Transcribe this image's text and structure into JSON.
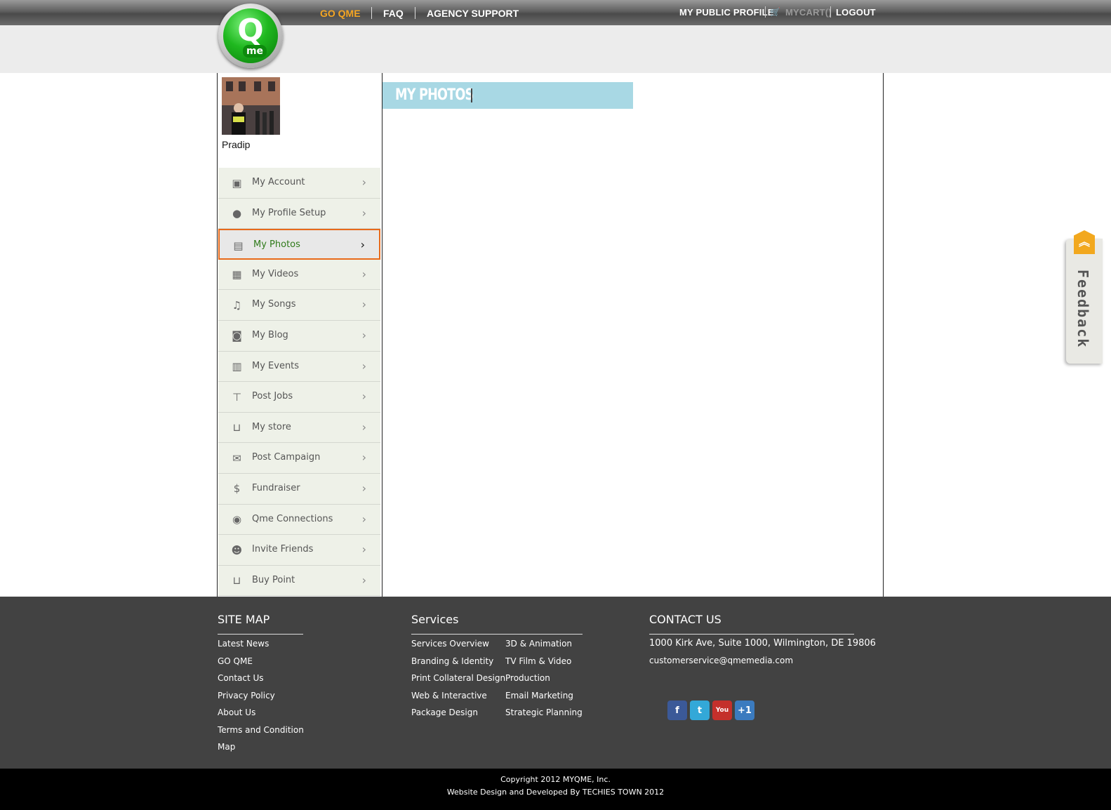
{
  "header": {
    "logo_letter": "Q",
    "logo_sub": "me",
    "nav": [
      {
        "label": "GO QME",
        "color": "#f5a623"
      },
      {
        "label": "FAQ"
      },
      {
        "label": "AGENCY SUPPORT"
      }
    ],
    "right_nav": {
      "public_profile": "MY PUBLIC PROFILE",
      "cart": "MYCART()",
      "logout": "LOGOUT"
    }
  },
  "user": {
    "name": "Pradip"
  },
  "sidebar": {
    "items": [
      {
        "label": "My Account",
        "icon": "account-icon",
        "glyph": "▣"
      },
      {
        "label": "My Profile Setup",
        "icon": "person-icon",
        "glyph": "●"
      },
      {
        "label": "My Photos",
        "icon": "photos-icon",
        "glyph": "▤",
        "active": true
      },
      {
        "label": "My Videos",
        "icon": "clapper-icon",
        "glyph": "▦"
      },
      {
        "label": "My Songs",
        "icon": "music-icon",
        "glyph": "♫"
      },
      {
        "label": "My Blog",
        "icon": "blog-icon",
        "glyph": "◙"
      },
      {
        "label": "My Events",
        "icon": "calendar-icon",
        "glyph": "▥"
      },
      {
        "label": "Post Jobs",
        "icon": "signpost-icon",
        "glyph": "⊤"
      },
      {
        "label": "My store",
        "icon": "cart-icon",
        "glyph": "⊔"
      },
      {
        "label": "Post Campaign",
        "icon": "envelope-icon",
        "glyph": "✉"
      },
      {
        "label": "Fundraiser",
        "icon": "dollar-icon",
        "glyph": "$"
      },
      {
        "label": "Qme Connections",
        "icon": "qme-icon",
        "glyph": "◉"
      },
      {
        "label": "Invite Friends",
        "icon": "friends-icon",
        "glyph": "☻"
      },
      {
        "label": "Buy Point",
        "icon": "basket-icon",
        "glyph": "⊔"
      }
    ],
    "arrow": "›"
  },
  "main": {
    "title": "MY PHOTOS"
  },
  "feedback": {
    "label": "Feedback",
    "button": "︽"
  },
  "footer": {
    "sitemap": {
      "heading": "SITE MAP",
      "links": [
        "Latest News",
        "GO QME",
        "Contact Us",
        "Privacy Policy",
        "About Us",
        "Terms and Condition",
        "Map"
      ]
    },
    "services": {
      "heading": "Services",
      "col1": [
        "Services Overview",
        "Branding & Identity",
        "Print Collateral Design",
        "Web & Interactive",
        "Package Design"
      ],
      "col2": [
        "3D & Animation",
        "TV Film & Video",
        "Production",
        "Email Marketing",
        "Strategic Planning"
      ]
    },
    "contact": {
      "heading": "CONTACT US",
      "address": "1000 Kirk Ave, Suite 1000, Wilmington, DE 19806",
      "email": "customerservice@qmemedia.com"
    },
    "social": [
      {
        "name": "facebook-icon",
        "glyph": "f",
        "color": "#3b5998"
      },
      {
        "name": "twitter-icon",
        "glyph": "t",
        "color": "#33a8d8"
      },
      {
        "name": "youtube-icon",
        "glyph": "You",
        "color": "#c4302b"
      },
      {
        "name": "googleplus-icon",
        "glyph": "+1",
        "color": "#3b7bbf"
      }
    ],
    "copyright": "Copyright 2012 MYQME, Inc.",
    "credit": "Website Design and Developed By TECHIES TOWN 2012"
  }
}
